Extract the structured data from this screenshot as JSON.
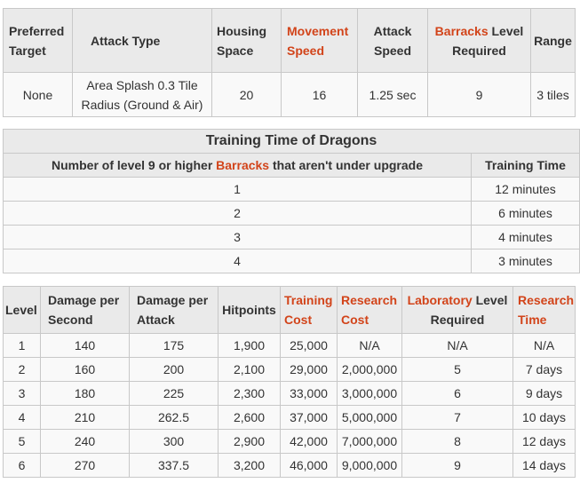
{
  "stats_table": {
    "headers": {
      "preferred_target": "Preferred Target",
      "attack_type": "Attack Type",
      "housing_space": "Housing Space",
      "movement_speed": "Movement Speed",
      "attack_speed": "Attack Speed",
      "barracks_word": "Barracks",
      "barracks_rest": " Level Required",
      "range": "Range"
    },
    "row": {
      "preferred_target": "None",
      "attack_type": "Area Splash 0.3 Tile Radius (Ground & Air)",
      "housing_space": "20",
      "movement_speed": "16",
      "attack_speed": "1.25 sec",
      "barracks_level": "9",
      "range": "3 tiles"
    }
  },
  "training_table": {
    "caption": "Training Time of Dragons",
    "header_col1_before": "Number of level 9 or higher ",
    "header_col1_link": "Barracks",
    "header_col1_after": " that aren't under upgrade",
    "header_col2": "Training Time",
    "rows": [
      {
        "barracks": "1",
        "time": "12 minutes"
      },
      {
        "barracks": "2",
        "time": "6 minutes"
      },
      {
        "barracks": "3",
        "time": "4 minutes"
      },
      {
        "barracks": "4",
        "time": "3 minutes"
      }
    ]
  },
  "level_table": {
    "headers": {
      "level": "Level",
      "dps": "Damage per Second",
      "dpa": "Damage per Attack",
      "hitpoints": "Hitpoints",
      "training_cost": "Training Cost",
      "research_cost": "Research Cost",
      "lab_word": "Laboratory",
      "lab_rest": " Level Required",
      "research_time": "Research Time"
    },
    "rows": [
      {
        "level": "1",
        "dps": "140",
        "dpa": "175",
        "hp": "1,900",
        "training_cost": "25,000",
        "research_cost": "N/A",
        "lab": "N/A",
        "time": "N/A"
      },
      {
        "level": "2",
        "dps": "160",
        "dpa": "200",
        "hp": "2,100",
        "training_cost": "29,000",
        "research_cost": "2,000,000",
        "lab": "5",
        "time": "7 days"
      },
      {
        "level": "3",
        "dps": "180",
        "dpa": "225",
        "hp": "2,300",
        "training_cost": "33,000",
        "research_cost": "3,000,000",
        "lab": "6",
        "time": "9 days"
      },
      {
        "level": "4",
        "dps": "210",
        "dpa": "262.5",
        "hp": "2,600",
        "training_cost": "37,000",
        "research_cost": "5,000,000",
        "lab": "7",
        "time": "10 days"
      },
      {
        "level": "5",
        "dps": "240",
        "dpa": "300",
        "hp": "2,900",
        "training_cost": "42,000",
        "research_cost": "7,000,000",
        "lab": "8",
        "time": "12 days"
      },
      {
        "level": "6",
        "dps": "270",
        "dpa": "337.5",
        "hp": "3,200",
        "training_cost": "46,000",
        "research_cost": "9,000,000",
        "lab": "9",
        "time": "14 days"
      }
    ]
  },
  "colors": {
    "link": "#d2441a",
    "header_bg": "#eaeaea",
    "cell_bg": "#f9f9f9",
    "border": "#c8c8c8"
  }
}
